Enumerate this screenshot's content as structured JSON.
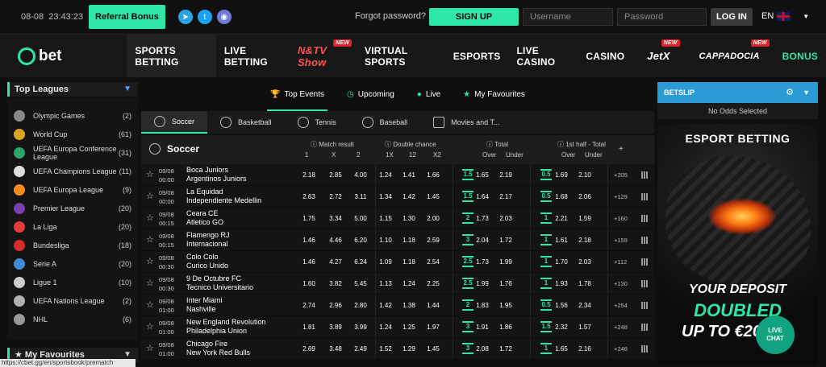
{
  "topbar": {
    "date": "08-08",
    "time": "23:43:23",
    "referral_label": "Referral Bonus",
    "forgot_label": "Forgot password?",
    "signup_label": "SIGN UP",
    "username_placeholder": "Username",
    "password_placeholder": "Password",
    "login_label": "LOG IN",
    "lang": "EN"
  },
  "nav": {
    "logo_text": "bet",
    "items": [
      {
        "label": "SPORTS BETTING",
        "new": false
      },
      {
        "label": "LIVE BETTING",
        "new": false
      },
      {
        "label": "N&TV Show",
        "new": true
      },
      {
        "label": "VIRTUAL SPORTS",
        "new": false
      },
      {
        "label": "ESPORTS",
        "new": false
      },
      {
        "label": "LIVE CASINO",
        "new": false
      },
      {
        "label": "CASINO",
        "new": false
      },
      {
        "label": "JetX",
        "new": true
      },
      {
        "label": "CAPPADOCIA",
        "new": true
      },
      {
        "label": "BONUS",
        "new": false
      }
    ],
    "new_badge": "NEW"
  },
  "leagues": {
    "title": "Top Leagues",
    "items": [
      {
        "name": "Olympic Games",
        "count": "(2)",
        "color": "#888888"
      },
      {
        "name": "World Cup",
        "count": "(61)",
        "color": "#d9a520"
      },
      {
        "name": "UEFA Europa Conference League",
        "count": "(31)",
        "color": "#2ea36b"
      },
      {
        "name": "UEFA Champions League",
        "count": "(11)",
        "color": "#dddddd"
      },
      {
        "name": "UEFA Europa League",
        "count": "(9)",
        "color": "#f08a1c"
      },
      {
        "name": "Premier League",
        "count": "(20)",
        "color": "#7b3fb0"
      },
      {
        "name": "La Liga",
        "count": "(20)",
        "color": "#e23b3b"
      },
      {
        "name": "Bundesliga",
        "count": "(18)",
        "color": "#d62b2b"
      },
      {
        "name": "Serie A",
        "count": "(20)",
        "color": "#3c8fd6"
      },
      {
        "name": "Ligue 1",
        "count": "(10)",
        "color": "#cccccc"
      },
      {
        "name": "UEFA Nations League",
        "count": "(2)",
        "color": "#b0b0b0"
      },
      {
        "name": "NHL",
        "count": "(6)",
        "color": "#9a9a9a"
      }
    ],
    "favourites_label": "My Favourites"
  },
  "filters": {
    "top_tabs": [
      "Top Events",
      "Upcoming",
      "Live",
      "My Favourites"
    ],
    "sport_tabs": [
      "Soccer",
      "Basketball",
      "Tennis",
      "Baseball",
      "Movies and T..."
    ]
  },
  "table": {
    "sport": "Soccer",
    "groups": [
      "Match result",
      "Double chance",
      "Total",
      "1st half - Total"
    ],
    "sub_mr": [
      "1",
      "X",
      "2"
    ],
    "sub_dc": [
      "1X",
      "12",
      "X2"
    ],
    "sub_tot": [
      "Over",
      "Under"
    ],
    "sub_ht": [
      "Over",
      "Under"
    ],
    "plus": "+",
    "rows": [
      {
        "date": "09/08",
        "time": "00:00",
        "home": "Boca Juniors",
        "away": "Argentinos Juniors",
        "mr": [
          "2.18",
          "2.85",
          "4.00"
        ],
        "dc": [
          "1.24",
          "1.41",
          "1.66"
        ],
        "tl": "1.5",
        "tot": [
          "1.65",
          "2.19"
        ],
        "hl": "0.5",
        "ht": [
          "1.69",
          "2.10"
        ],
        "more": "+205"
      },
      {
        "date": "09/08",
        "time": "00:00",
        "home": "La Equidad",
        "away": "Independiente Medellin",
        "mr": [
          "2.63",
          "2.72",
          "3.11"
        ],
        "dc": [
          "1.34",
          "1.42",
          "1.45"
        ],
        "tl": "1.5",
        "tot": [
          "1.64",
          "2.17"
        ],
        "hl": "0.5",
        "ht": [
          "1.68",
          "2.06"
        ],
        "more": "+129"
      },
      {
        "date": "09/08",
        "time": "00:15",
        "home": "Ceara CE",
        "away": "Atletico GO",
        "mr": [
          "1.75",
          "3.34",
          "5.00"
        ],
        "dc": [
          "1.15",
          "1.30",
          "2.00"
        ],
        "tl": "2",
        "tot": [
          "1.73",
          "2.03"
        ],
        "hl": "1",
        "ht": [
          "2.21",
          "1.59"
        ],
        "more": "+160"
      },
      {
        "date": "09/08",
        "time": "00:15",
        "home": "Flamengo RJ",
        "away": "Internacional",
        "mr": [
          "1.46",
          "4.46",
          "6.20"
        ],
        "dc": [
          "1.10",
          "1.18",
          "2.59"
        ],
        "tl": "3",
        "tot": [
          "2.04",
          "1.72"
        ],
        "hl": "1",
        "ht": [
          "1.61",
          "2.18"
        ],
        "more": "+159"
      },
      {
        "date": "09/08",
        "time": "00:30",
        "home": "Colo Colo",
        "away": "Curico Unido",
        "mr": [
          "1.46",
          "4.27",
          "6.24"
        ],
        "dc": [
          "1.09",
          "1.18",
          "2.54"
        ],
        "tl": "2.5",
        "tot": [
          "1.73",
          "1.99"
        ],
        "hl": "1",
        "ht": [
          "1.70",
          "2.03"
        ],
        "more": "+112"
      },
      {
        "date": "09/08",
        "time": "00:30",
        "home": "9 De Octubre FC",
        "away": "Tecnico Universitario",
        "mr": [
          "1.60",
          "3.82",
          "5.45"
        ],
        "dc": [
          "1.13",
          "1.24",
          "2.25"
        ],
        "tl": "2.5",
        "tot": [
          "1.99",
          "1.76"
        ],
        "hl": "1",
        "ht": [
          "1.93",
          "1.78"
        ],
        "more": "+130"
      },
      {
        "date": "09/08",
        "time": "01:00",
        "home": "Inter Miami",
        "away": "Nashville",
        "mr": [
          "2.74",
          "2.96",
          "2.80"
        ],
        "dc": [
          "1.42",
          "1.38",
          "1.44"
        ],
        "tl": "2",
        "tot": [
          "1.83",
          "1.95"
        ],
        "hl": "0.5",
        "ht": [
          "1.56",
          "2.34"
        ],
        "more": "+254"
      },
      {
        "date": "09/08",
        "time": "01:00",
        "home": "New England Revolution",
        "away": "Philadelphia Union",
        "mr": [
          "1.81",
          "3.89",
          "3.99"
        ],
        "dc": [
          "1.24",
          "1.25",
          "1.97"
        ],
        "tl": "3",
        "tot": [
          "1.91",
          "1.86"
        ],
        "hl": "1.5",
        "ht": [
          "2.32",
          "1.57"
        ],
        "more": "+248"
      },
      {
        "date": "09/08",
        "time": "01:00",
        "home": "Chicago Fire",
        "away": "New York Red Bulls",
        "mr": [
          "2.69",
          "3.48",
          "2.49"
        ],
        "dc": [
          "1.52",
          "1.29",
          "1.45"
        ],
        "tl": "3",
        "tot": [
          "2.08",
          "1.72"
        ],
        "hl": "1",
        "ht": [
          "1.65",
          "2.16"
        ],
        "more": "+248"
      }
    ]
  },
  "betslip": {
    "title": "BETSLIP",
    "empty": "No Odds Selected",
    "banner_title": "ESPORT BETTING",
    "your_deposit": "YOUR DEPOSIT",
    "doubled": "DOUBLED",
    "upto": "UP TO €200"
  },
  "chat": {
    "label1": "LIVE",
    "label2": "CHAT"
  },
  "status_url": "https://cbet.gg/en/sportsbook/prematch"
}
